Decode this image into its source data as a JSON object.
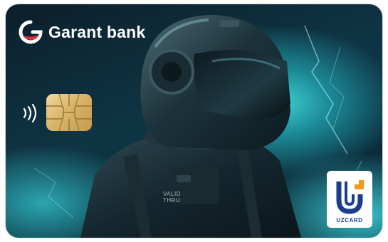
{
  "card": {
    "bank_name": "Garant bank",
    "valid_line1": "VALID",
    "valid_line2": "THRU",
    "network_name": "UZCARD"
  },
  "colors": {
    "logo_red": "#e8313a",
    "network_blue": "#1b3d8a",
    "network_orange": "#f39a1e",
    "chip_gold": "#d9b56a",
    "background_teal": "#1b8c98"
  },
  "icons": {
    "contactless": "contactless-icon",
    "chip": "chip-icon",
    "bank_logo": "garant-bank-logo-icon",
    "network_logo": "uzcard-logo-icon"
  }
}
